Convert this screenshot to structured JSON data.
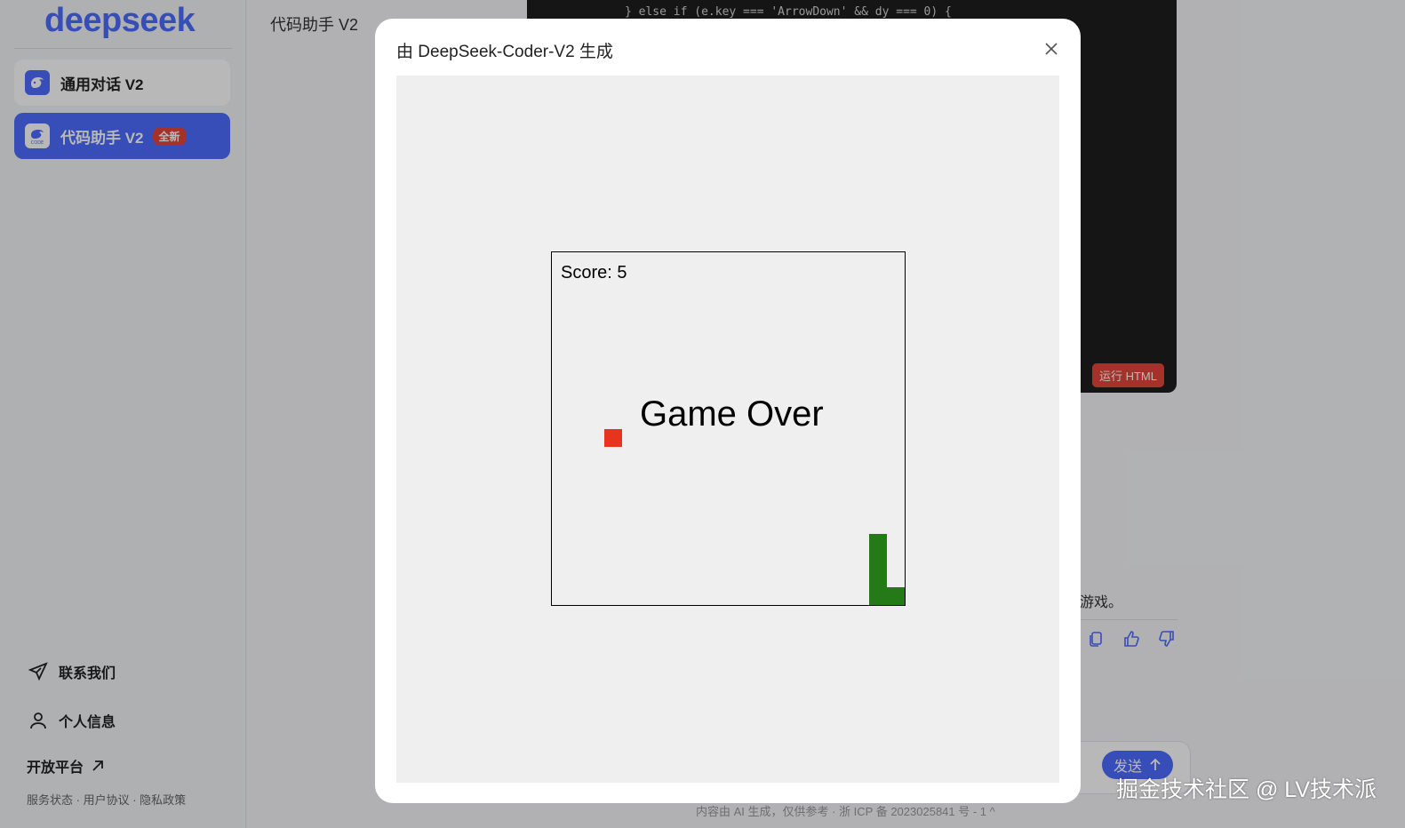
{
  "sidebar": {
    "logo": "deepseek",
    "nav": [
      {
        "label": "通用对话 V2",
        "icon": "chat-whale-icon"
      },
      {
        "label": "代码助手 V2",
        "icon": "code-whale-icon",
        "badge": "全新"
      }
    ],
    "contact_label": "联系我们",
    "profile_label": "个人信息",
    "platform_label": "开放平台",
    "footer": {
      "status": "服务状态",
      "agreement": "用户协议",
      "privacy": "隐私政策",
      "separator": " · "
    }
  },
  "main": {
    "title": "代码助手 V2",
    "code_line": "} else if (e.key === 'ArrowDown' && dy === 0) {",
    "run_html_label": "运行 HTML",
    "chat_snippet": "游戏。",
    "send_label": "发送",
    "bottom_note": "内容由 AI 生成，仅供参考 · 浙 ICP 备 2023025841 号 - 1 ^",
    "watermark": "掘金技术社区 @ LV技术派"
  },
  "modal": {
    "title": "由 DeepSeek-Coder-V2 生成",
    "close_icon": "close-icon",
    "game": {
      "score_label": "Score: 5",
      "status": "Game Over",
      "colors": {
        "food": "#e8341c",
        "snake": "#247a17",
        "background": "#efefef",
        "border": "#000000"
      }
    }
  },
  "colors": {
    "brand": "#4d6bfe",
    "badge": "#e5463b"
  }
}
